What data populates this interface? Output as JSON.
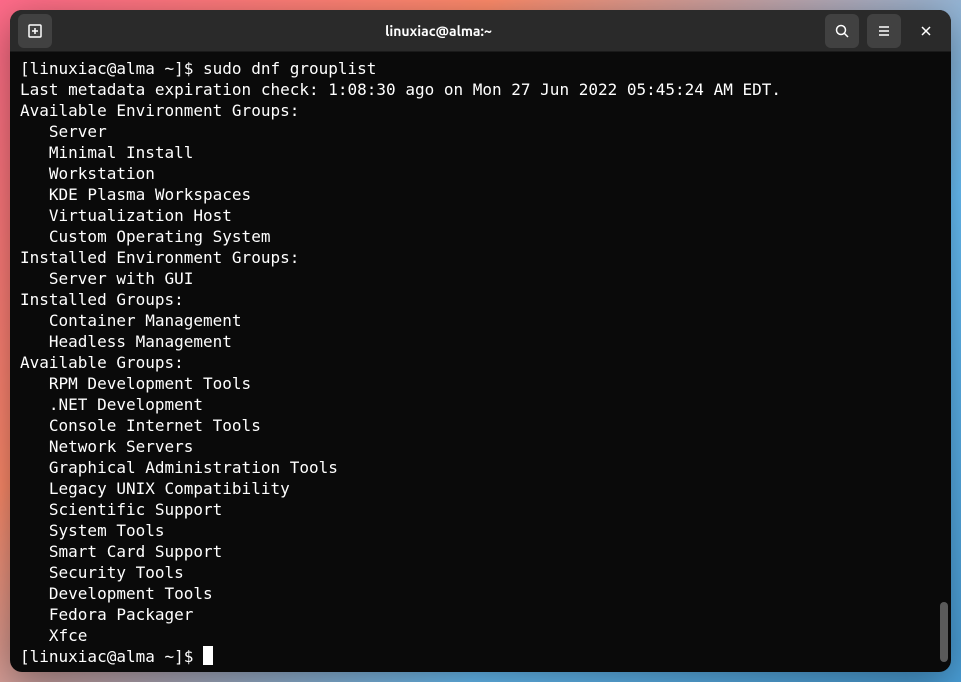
{
  "window": {
    "title": "linuxiac@alma:~"
  },
  "prompt1": "[linuxiac@alma ~]$ ",
  "command": "sudo dnf grouplist",
  "output": {
    "metadata": "Last metadata expiration check: 1:08:30 ago on Mon 27 Jun 2022 05:45:24 AM EDT.",
    "heading_avail_env": "Available Environment Groups:",
    "avail_env": [
      "Server",
      "Minimal Install",
      "Workstation",
      "KDE Plasma Workspaces",
      "Virtualization Host",
      "Custom Operating System"
    ],
    "heading_inst_env": "Installed Environment Groups:",
    "inst_env": [
      "Server with GUI"
    ],
    "heading_inst_groups": "Installed Groups:",
    "inst_groups": [
      "Container Management",
      "Headless Management"
    ],
    "heading_avail_groups": "Available Groups:",
    "avail_groups": [
      "RPM Development Tools",
      ".NET Development",
      "Console Internet Tools",
      "Network Servers",
      "Graphical Administration Tools",
      "Legacy UNIX Compatibility",
      "Scientific Support",
      "System Tools",
      "Smart Card Support",
      "Security Tools",
      "Development Tools",
      "Fedora Packager",
      "Xfce"
    ]
  },
  "prompt2": "[linuxiac@alma ~]$ "
}
